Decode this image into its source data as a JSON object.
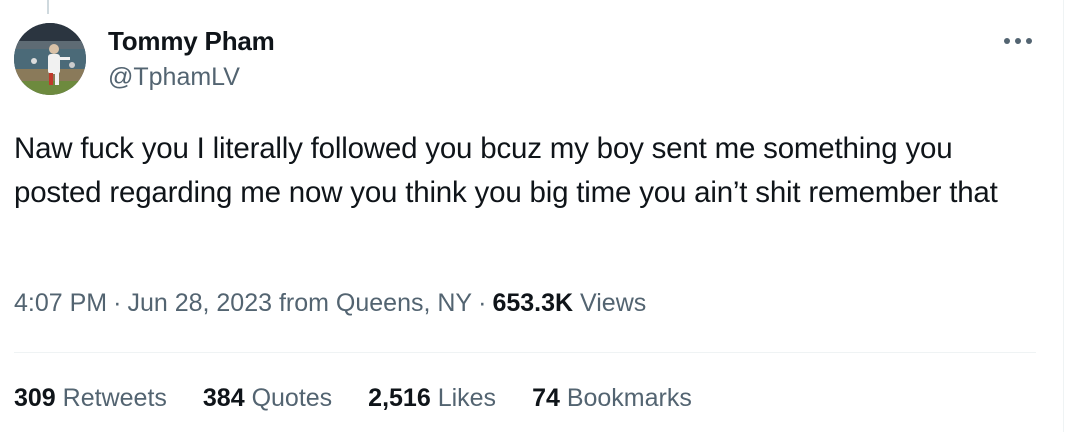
{
  "author": {
    "display_name": "Tommy Pham",
    "handle": "@TphamLV"
  },
  "icons": {
    "more": "more-horizontal-icon",
    "avatar": "baseball-player-photo"
  },
  "tweet": {
    "text": "Naw fuck you I literally followed you bcuz my boy sent me something you posted regarding me now you think you big time you ain’t shit remember that",
    "time": "4:07 PM",
    "date": "Jun 28, 2023",
    "location": "from Queens, NY",
    "separator": "·",
    "views_count": "653.3K",
    "views_label": "Views"
  },
  "stats": {
    "retweets_count": "309",
    "retweets_label": "Retweets",
    "quotes_count": "384",
    "quotes_label": "Quotes",
    "likes_count": "2,516",
    "likes_label": "Likes",
    "bookmarks_count": "74",
    "bookmarks_label": "Bookmarks"
  },
  "colors": {
    "text_primary": "#0f1419",
    "text_secondary": "#536471",
    "divider": "#eff3f4"
  }
}
